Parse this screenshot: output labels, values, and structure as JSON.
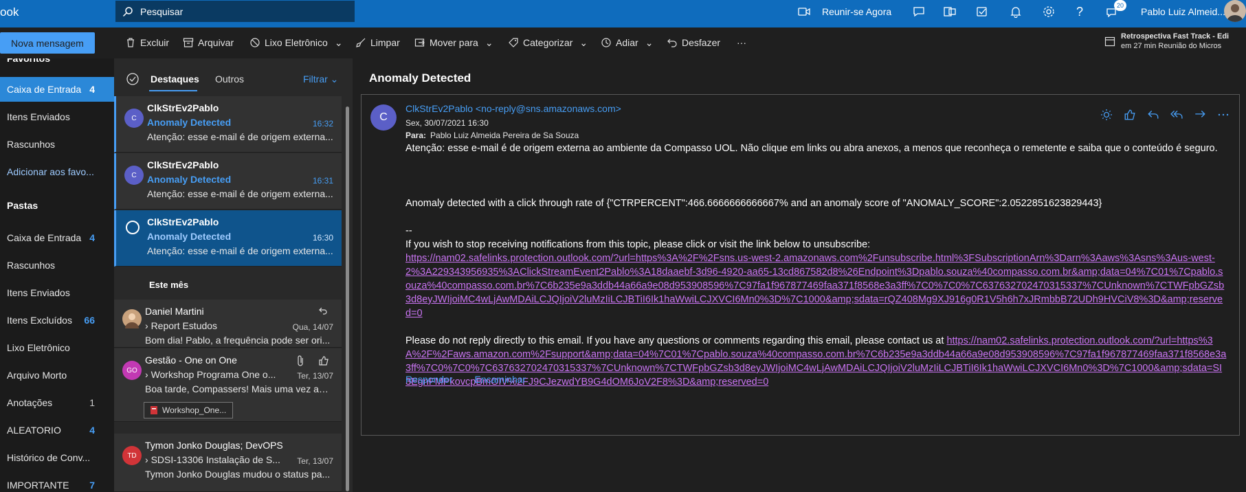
{
  "topbar": {
    "brand": "ook",
    "search_placeholder": "Pesquisar",
    "meet_now": "Reunir-se Agora",
    "user_name": "Pablo Luiz Almeid...",
    "notif_count": "20"
  },
  "command": {
    "new_message": "Nova mensagem",
    "delete": "Excluir",
    "archive": "Arquivar",
    "junk": "Lixo Eletrônico",
    "sweep": "Limpar",
    "move_to": "Mover para",
    "categorize": "Categorizar",
    "snooze": "Adiar",
    "undo": "Desfazer",
    "more": "···"
  },
  "reminder": {
    "title": "Retrospectiva Fast Track - Edi",
    "subtitle": "em 27 min Reunião do Micros"
  },
  "leftnav": {
    "favorites_head": "Favoritos",
    "favorites": [
      {
        "label": "Caixa de Entrada",
        "count": "4"
      },
      {
        "label": "Itens Enviados",
        "count": ""
      },
      {
        "label": "Rascunhos",
        "count": ""
      },
      {
        "label": "Adicionar aos favo...",
        "count": ""
      }
    ],
    "folders_head": "Pastas",
    "folders": [
      {
        "label": "Caixa de Entrada",
        "count": "4"
      },
      {
        "label": "Rascunhos",
        "count": ""
      },
      {
        "label": "Itens Enviados",
        "count": ""
      },
      {
        "label": "Itens Excluídos",
        "count": "66"
      },
      {
        "label": "Lixo Eletrônico",
        "count": ""
      },
      {
        "label": "Arquivo Morto",
        "count": ""
      },
      {
        "label": "Anotações",
        "count": "1"
      },
      {
        "label": "ALEATORIO",
        "count": "4"
      },
      {
        "label": "Histórico de Conv...",
        "count": ""
      },
      {
        "label": "IMPORTANTE",
        "count": "7"
      }
    ]
  },
  "list": {
    "tab_focused": "Destaques",
    "tab_other": "Outros",
    "filter": "Filtrar",
    "section_month": "Este mês",
    "messages": [
      {
        "initials": "C",
        "sender": "ClkStrEv2Pablo",
        "subject": "Anomaly Detected",
        "time": "16:32",
        "preview": "Atenção: esse e-mail é de origem externa..."
      },
      {
        "initials": "C",
        "sender": "ClkStrEv2Pablo",
        "subject": "Anomaly Detected",
        "time": "16:31",
        "preview": "Atenção: esse e-mail é de origem externa..."
      },
      {
        "initials": "",
        "sender": "ClkStrEv2Pablo",
        "subject": "Anomaly Detected",
        "time": "16:30",
        "preview": "Atenção: esse e-mail é de origem externa..."
      },
      {
        "initials": "",
        "sender": "Daniel Martini",
        "subject": "Report Estudos",
        "time": "Qua, 14/07",
        "preview": "Bom dia! Pablo, a frequência pode ser ori..."
      },
      {
        "initials": "GO",
        "sender": "Gestão - One on One",
        "subject": "Workshop Programa One o...",
        "time": "Ter, 13/07",
        "preview": "Boa tarde, Compassers! Mais uma vez agr...",
        "attachment": "Workshop_One..."
      },
      {
        "initials": "TD",
        "sender": "Tymon Jonko Douglas; DevOPS",
        "subject": "SDSI-13306 Instalação de S...",
        "time": "Ter, 13/07",
        "preview": "Tymon Jonko Douglas mudou o status pa..."
      }
    ]
  },
  "reading": {
    "title": "Anomaly Detected",
    "avatar": "C",
    "from": "ClkStrEv2Pablo <no-reply@sns.amazonaws.com>",
    "date": "Sex, 30/07/2021 16:30",
    "to_label": "Para:",
    "to": "Pablo Luiz Almeida Pereira de Sa Souza",
    "warning": "Atenção: esse e-mail é de origem externa ao ambiente da Compasso UOL. Não clique em links ou abra anexos, a menos que reconheça o remetente e saiba que o conteúdo é seguro.",
    "anomaly_line": "Anomaly detected with a click through rate of {\"CTRPERCENT\":466.6666666666667% and an anomaly score of \"ANOMALY_SCORE\":2.0522851623829443}",
    "separator": "--",
    "unsub_text": "If you wish to stop receiving notifications from this topic, please click or visit the link below to unsubscribe:",
    "unsub_link": "https://nam02.safelinks.protection.outlook.com/?url=https%3A%2F%2Fsns.us-west-2.amazonaws.com%2Funsubscribe.html%3FSubscriptionArn%3Darn%3Aaws%3Asns%3Aus-west-2%3A229343956935%3AClickStreamEvent2Pablo%3A18daaebf-3d96-4920-aa65-13cd867582d8%26Endpoint%3Dpablo.souza%40compasso.com.br&amp;data=04%7C01%7Cpablo.souza%40compasso.com.br%7C6b235e9a3ddb44a66a9e08d953908596%7C97fa1f967877469faa371f8568e3a3ff%7C0%7C0%7C637632702470315337%7CUnknown%7CTWFpbGZsb3d8eyJWIjoiMC4wLjAwMDAiLCJQIjoiV2luMzIiLCJBTiI6Ik1haWwiLCJXVCI6Mn0%3D%7C1000&amp;sdata=rQZ408Mg9XJ916g0R1V5h6h7xJRmbbB72UDh9HVCiV8%3D&amp;reserved=0",
    "noreply_text": "Please do not reply directly to this email. If you have any questions or comments regarding this email, please contact us at",
    "noreply_link": "https://nam02.safelinks.protection.outlook.com/?url=https%3A%2F%2Faws.amazon.com%2Fsupport&amp;data=04%7C01%7Cpablo.souza%40compasso.com.br%7C6b235e9a3ddb44a66a9e08d953908596%7C97fa1f967877469faa371f8568e3a3ff%7C0%7C0%7C637632702470315337%7CUnknown%7CTWFpbGZsb3d8eyJWIjoiMC4wLjAwMDAiLCJQIjoiV2luMzIiLCJBTiI6Ik1haWwiLCJXVCI6Mn0%3D%7C1000&amp;sdata=SI3EgnFMPkovcpBmOIV%2FJ9CJezwdYB9G4dOM6JoV2F8%3D&amp;reserved=0",
    "reply": "Responder",
    "forward": "Encaminhar"
  },
  "colors": {
    "accent": "#479ef5",
    "topbar": "#0f6cbd",
    "link": "#c974f2"
  }
}
